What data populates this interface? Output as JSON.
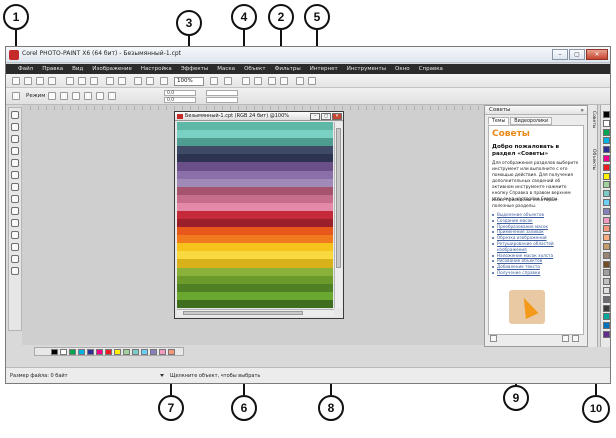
{
  "window": {
    "title": "Corel PHOTO-PAINT X6 (64 бит) - Безымянный-1.cpt",
    "controls": {
      "minimize": "–",
      "maximize": "▢",
      "close": "✕"
    }
  },
  "menu": [
    "Файл",
    "Правка",
    "Вид",
    "Изображение",
    "Настройка",
    "Эффекты",
    "Маска",
    "Объект",
    "Фильтры",
    "Интернет",
    "Инструменты",
    "Окно",
    "Справка"
  ],
  "toolbar": {
    "zoom": "100%"
  },
  "property_bar": {
    "mode_label": "Режим",
    "x_value": "0,0",
    "y_value": "0,0"
  },
  "document": {
    "title": "Безымянный-1.cpt (RGB 24 бит) @100%",
    "controls": {
      "minimize": "–",
      "maximize": "▢",
      "close": "✕"
    },
    "stripes": [
      "#5fb8a6",
      "#7ad0c2",
      "#4f9c90",
      "#3f4a66",
      "#2d3452",
      "#6a4f88",
      "#8b6fa8",
      "#a08ab8",
      "#a6546e",
      "#c66d8c",
      "#e48aa8",
      "#c42a3a",
      "#9b1e2b",
      "#e8571b",
      "#f27a1e",
      "#f6c21c",
      "#f9d840",
      "#d9b21b",
      "#8ab23a",
      "#6c9b2c",
      "#4f8024",
      "#6aa830",
      "#3f6e1f"
    ]
  },
  "docker": {
    "header": "Советы",
    "tabs": [
      "Темы",
      "Видеоролики"
    ],
    "title": "Советы",
    "heading": "Добро пожаловать в раздел «Советы»",
    "paragraph1": "Для отображения разделов выберите инструмент или выполните с его помощью действие. Для получения дополнительных сведений об активном инструменте нажмите кнопку Справка в правом верхнем углу окна настройки Советы.",
    "paragraph2": "Ниже приведены некоторые полезные разделы.",
    "links": [
      "Выделение объектов",
      "Создание масок",
      "Преобразование масок",
      "Применение заливок",
      "Обрезка изображений",
      "Ретуширование областей изображения",
      "Наложение масок холста",
      "Рисование объектов",
      "Добавление текста",
      "Получение справки"
    ],
    "side_tabs": [
      "Советы",
      "Объекты"
    ]
  },
  "palette_colors": [
    "#000000",
    "#ffffff",
    "#00a650",
    "#00b3e3",
    "#2e3192",
    "#ec008c",
    "#ed1c24",
    "#fff200",
    "#a3d39c",
    "#7accc8",
    "#6dcff6",
    "#8781bd",
    "#f49ac2",
    "#f7977a",
    "#f9ad81",
    "#c69c6d",
    "#998675",
    "#754c24",
    "#a0a0a0",
    "#c0c0c0",
    "#e0e0e0",
    "#6d6e71",
    "#3b3b3b",
    "#00a99d",
    "#0072bc",
    "#662d91"
  ],
  "status": {
    "file_size": "Размер файла: 0 байт",
    "message": "Щелкните объект, чтобы выбрать"
  },
  "callouts": [
    "1",
    "2",
    "3",
    "4",
    "5",
    "6",
    "7",
    "8",
    "9",
    "10"
  ]
}
